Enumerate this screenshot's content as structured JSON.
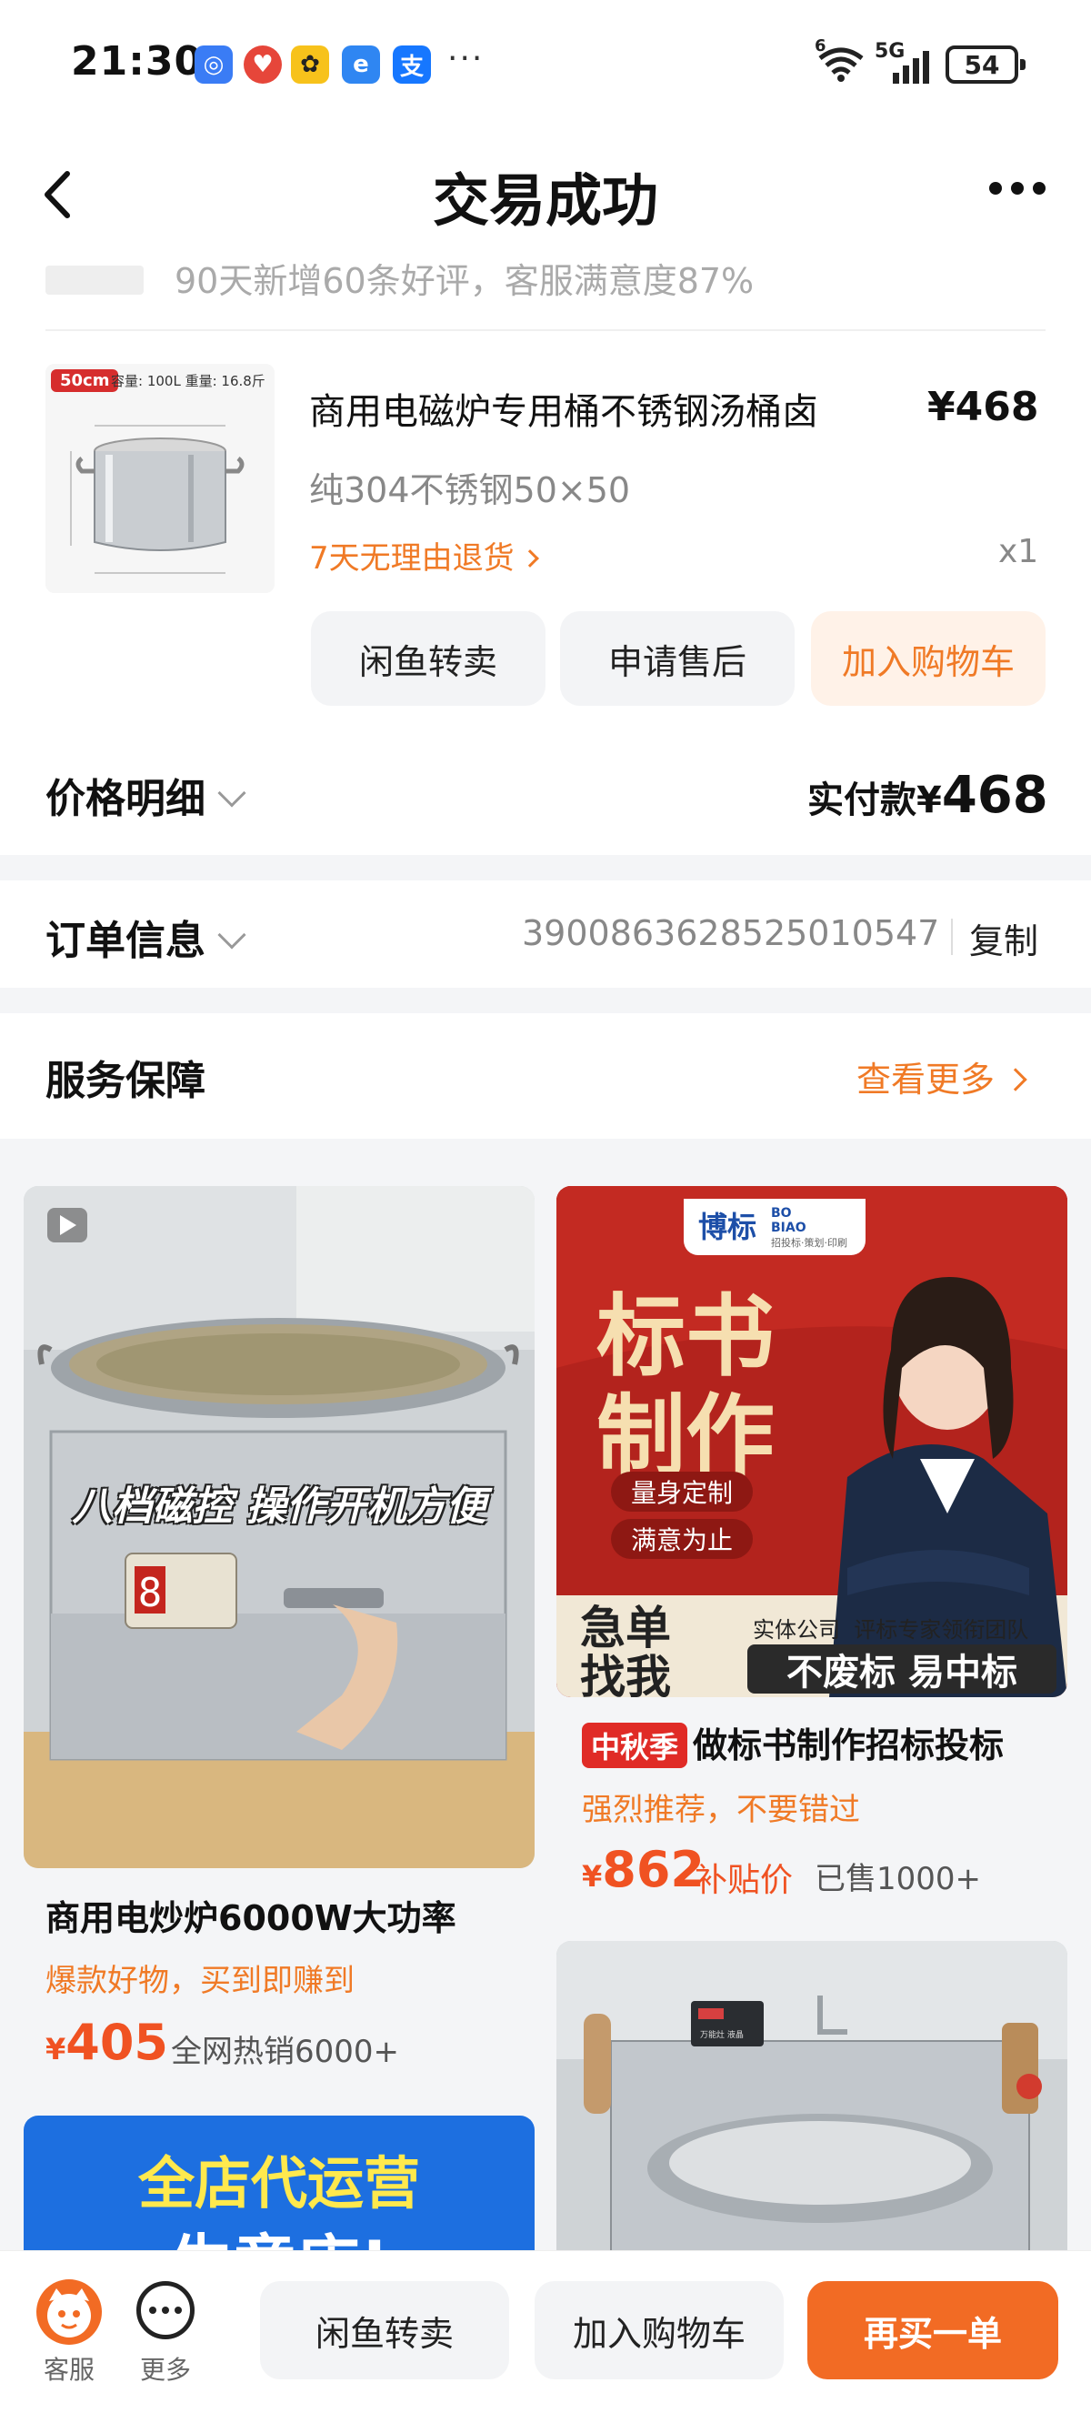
{
  "status_bar": {
    "time": "21:30",
    "app_icons": [
      {
        "name": "app-icon-1",
        "color": "#3a7cf5"
      },
      {
        "name": "app-icon-2",
        "color": "#e6463a"
      },
      {
        "name": "app-icon-3",
        "color": "#f7c21b"
      },
      {
        "name": "app-icon-4",
        "color": "#2f86f2"
      },
      {
        "name": "alipay-icon",
        "color": "#1677ff"
      }
    ],
    "more_glyph": "···",
    "network_6": "6",
    "network_5g": "5G",
    "battery": "54"
  },
  "nav": {
    "title": "交易成功"
  },
  "order": {
    "faded_line": "90天新增60条好评，客服满意度87%",
    "product": {
      "image_tag": "50cm",
      "image_specs": "容量: 100L   重量: 16.8斤",
      "name": "商用电磁炉专用桶不锈钢汤桶卤",
      "price": "¥468",
      "spec": "纯304不锈钢50×50",
      "return_policy": "7天无理由退货",
      "quantity": "x1"
    },
    "actions": [
      "闲鱼转卖",
      "申请售后",
      "加入购物车"
    ],
    "price_detail_label": "价格明细",
    "paid_label": "实付款¥",
    "paid_amount": "468"
  },
  "order_info": {
    "label": "订单信息",
    "order_no": "3900863628525010547",
    "copy_label": "复制"
  },
  "service": {
    "label": "服务保障",
    "more_label": "查看更多"
  },
  "feed": {
    "left": [
      {
        "overlay_text": "八档磁控 操作开机方便",
        "display_digit": "8",
        "title": "商用电炒炉6000W大功率",
        "subtitle": "爆款好物，买到即赚到",
        "price_symbol": "¥",
        "price": "405",
        "meta": "全网热销6000+"
      },
      {
        "banner_line1": "全店代运营",
        "banner_line2": "生意店!"
      }
    ],
    "right": [
      {
        "brand": "博标",
        "brand_en": "BO BIAO",
        "brand_sub": "招投标·策划·印刷",
        "big_text_1": "标书",
        "big_text_2": "制作",
        "pill_1": "量身定制",
        "pill_2": "满意为止",
        "urgent_1": "急单",
        "urgent_2": "找我",
        "team_text": "实体公司  评标专家领衔团队",
        "slogan": "不废标 易中标",
        "badge": "中秋季",
        "title": "做标书制作招标投标",
        "subtitle": "强烈推荐，不要错过",
        "price_symbol": "¥",
        "price": "862",
        "price_note": "补贴价",
        "meta": "已售1000+"
      },
      {
        "panel_label": "万能灶 液晶"
      }
    ]
  },
  "bottom_bar": {
    "service_label": "客服",
    "more_label": "更多",
    "resell_label": "闲鱼转卖",
    "cart_label": "加入购物车",
    "rebuy_label": "再买一单",
    "accent": "#f26b24"
  }
}
